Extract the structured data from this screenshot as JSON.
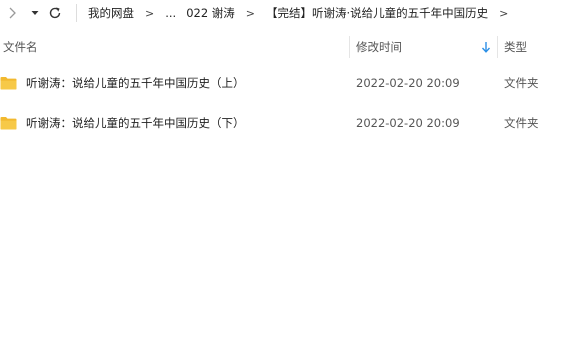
{
  "toolbar": {
    "back_icon": "chevron-right-icon",
    "dropdown_icon": "caret-down-icon",
    "refresh_icon": "refresh-icon"
  },
  "breadcrumb": {
    "items": [
      "我的网盘",
      "...",
      "022 谢涛",
      "【完结】听谢涛·说给儿童的五千年中国历史"
    ],
    "separator": ">"
  },
  "columns": {
    "name": "文件名",
    "modified": "修改时间",
    "type": "类型"
  },
  "files": [
    {
      "name": "听谢涛：说给儿童的五千年中国历史（上）",
      "modified": "2022-02-20 20:09",
      "type": "文件夹"
    },
    {
      "name": "听谢涛：说给儿童的五千年中国历史（下）",
      "modified": "2022-02-20 20:09",
      "type": "文件夹"
    }
  ],
  "colors": {
    "folder": "#f7c948",
    "folder_tab": "#f2b92f",
    "sort_arrow": "#2b8fe6"
  }
}
